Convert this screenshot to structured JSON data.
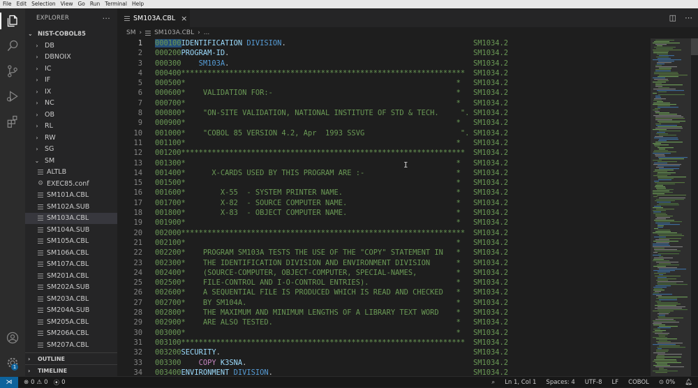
{
  "menu": [
    "File",
    "Edit",
    "Selection",
    "View",
    "Go",
    "Run",
    "Terminal",
    "Help"
  ],
  "explorer": {
    "title": "EXPLORER",
    "more": "···",
    "root": "NIST-COBOL85",
    "folders": [
      "DB",
      "DBNOIX",
      "IC",
      "IF",
      "IX",
      "NC",
      "OB",
      "RL",
      "RW",
      "SG"
    ],
    "open_folder": "SM",
    "files": [
      "ALTLB",
      "EXEC85.conf",
      "SM101A.CBL",
      "SM102A.SUB",
      "SM103A.CBL",
      "SM104A.SUB",
      "SM105A.CBL",
      "SM106A.CBL",
      "SM107A.CBL",
      "SM201A.CBL",
      "SM202A.SUB",
      "SM203A.CBL",
      "SM204A.SUB",
      "SM205A.CBL",
      "SM206A.CBL",
      "SM207A.CBL"
    ],
    "selected_file": "SM103A.CBL",
    "outline": "OUTLINE",
    "timeline": "TIMELINE"
  },
  "tab": {
    "label": "SM103A.CBL",
    "close": "×"
  },
  "breadcrumb": {
    "folder": "SM",
    "file": "SM103A.CBL",
    "more": "..."
  },
  "code": {
    "sequence_tag": "SM1034.2",
    "lines": [
      {
        "n": "1",
        "seq": "000100",
        "parts": [
          [
            "kw2",
            "IDENTIFICATION "
          ],
          [
            "kw",
            "DIVISION"
          ],
          [
            "txt",
            "."
          ]
        ]
      },
      {
        "n": "2",
        "seq": "000200",
        "parts": [
          [
            "kw2",
            "PROGRAM-ID"
          ],
          [
            "txt",
            "."
          ]
        ]
      },
      {
        "n": "3",
        "seq": "000300",
        "parts": [
          [
            "txt",
            "    "
          ],
          [
            "kw",
            "SM103A"
          ],
          [
            "txt",
            "."
          ]
        ]
      },
      {
        "n": "4",
        "seq": "000400",
        "parts": [
          [
            "cmt",
            "*****************************************************************"
          ]
        ]
      },
      {
        "n": "5",
        "seq": "000500",
        "parts": [
          [
            "cmt",
            "*                                                              *"
          ]
        ]
      },
      {
        "n": "6",
        "seq": "000600",
        "parts": [
          [
            "cmt",
            "*    VALIDATION FOR:-                                          *"
          ]
        ]
      },
      {
        "n": "7",
        "seq": "000700",
        "parts": [
          [
            "cmt",
            "*                                                              *"
          ]
        ]
      },
      {
        "n": "8",
        "seq": "000800",
        "parts": [
          [
            "cmt",
            "*    \"ON-SITE VALIDATION, NATIONAL INSTITUTE OF STD & TECH.     \"."
          ]
        ]
      },
      {
        "n": "9",
        "seq": "000900",
        "parts": [
          [
            "cmt",
            "*                                                              *"
          ]
        ]
      },
      {
        "n": "10",
        "seq": "001000",
        "parts": [
          [
            "cmt",
            "*    \"COBOL 85 VERSION 4.2, Apr  1993 SSVG                      \"."
          ]
        ]
      },
      {
        "n": "11",
        "seq": "001100",
        "parts": [
          [
            "cmt",
            "*                                                              *"
          ]
        ]
      },
      {
        "n": "12",
        "seq": "001200",
        "parts": [
          [
            "cmt",
            "*****************************************************************"
          ]
        ]
      },
      {
        "n": "13",
        "seq": "001300",
        "parts": [
          [
            "cmt",
            "*                                                              *"
          ]
        ]
      },
      {
        "n": "14",
        "seq": "001400",
        "parts": [
          [
            "cmt",
            "*      X-CARDS USED BY THIS PROGRAM ARE :-                     *"
          ]
        ]
      },
      {
        "n": "15",
        "seq": "001500",
        "parts": [
          [
            "cmt",
            "*                                                              *"
          ]
        ]
      },
      {
        "n": "16",
        "seq": "001600",
        "parts": [
          [
            "cmt",
            "*        X-55  - SYSTEM PRINTER NAME.                          *"
          ]
        ]
      },
      {
        "n": "17",
        "seq": "001700",
        "parts": [
          [
            "cmt",
            "*        X-82  - SOURCE COMPUTER NAME.                         *"
          ]
        ]
      },
      {
        "n": "18",
        "seq": "001800",
        "parts": [
          [
            "cmt",
            "*        X-83  - OBJECT COMPUTER NAME.                         *"
          ]
        ]
      },
      {
        "n": "19",
        "seq": "001900",
        "parts": [
          [
            "cmt",
            "*                                                              *"
          ]
        ]
      },
      {
        "n": "20",
        "seq": "002000",
        "parts": [
          [
            "cmt",
            "*****************************************************************"
          ]
        ]
      },
      {
        "n": "21",
        "seq": "002100",
        "parts": [
          [
            "cmt",
            "*                                                              *"
          ]
        ]
      },
      {
        "n": "22",
        "seq": "002200",
        "parts": [
          [
            "cmt",
            "*    PROGRAM SM103A TESTS THE USE OF THE \"COPY\" STATEMENT IN   *"
          ]
        ]
      },
      {
        "n": "23",
        "seq": "002300",
        "parts": [
          [
            "cmt",
            "*    THE IDENTIFICATION DIVISION AND ENVIRONMENT DIVISION      *"
          ]
        ]
      },
      {
        "n": "24",
        "seq": "002400",
        "parts": [
          [
            "cmt",
            "*    (SOURCE-COMPUTER, OBJECT-COMPUTER, SPECIAL-NAMES,         *"
          ]
        ]
      },
      {
        "n": "25",
        "seq": "002500",
        "parts": [
          [
            "cmt",
            "*    FILE-CONTROL AND I-O-CONTROL ENTRIES).                    *"
          ]
        ]
      },
      {
        "n": "26",
        "seq": "002600",
        "parts": [
          [
            "cmt",
            "*    A SEQUENTIAL FILE IS PRODUCED WHICH IS READ AND CHECKED   *"
          ]
        ]
      },
      {
        "n": "27",
        "seq": "002700",
        "parts": [
          [
            "cmt",
            "*    BY SM104A.                                                *"
          ]
        ]
      },
      {
        "n": "28",
        "seq": "002800",
        "parts": [
          [
            "cmt",
            "*    THE MAXIMUM AND MINIMUM LENGTHS OF A LIBRARY TEXT WORD    *"
          ]
        ]
      },
      {
        "n": "29",
        "seq": "002900",
        "parts": [
          [
            "cmt",
            "*    ARE ALSO TESTED.                                          *"
          ]
        ]
      },
      {
        "n": "30",
        "seq": "003000",
        "parts": [
          [
            "cmt",
            "*                                                              *"
          ]
        ]
      },
      {
        "n": "31",
        "seq": "003100",
        "parts": [
          [
            "cmt",
            "*****************************************************************"
          ]
        ]
      },
      {
        "n": "32",
        "seq": "003200",
        "parts": [
          [
            "kw2",
            "SECURITY"
          ],
          [
            "txt",
            "."
          ]
        ]
      },
      {
        "n": "33",
        "seq": "003300",
        "parts": [
          [
            "txt",
            "    "
          ],
          [
            "kw3",
            "COPY "
          ],
          [
            "kw2",
            "K3SNA"
          ],
          [
            "txt",
            "."
          ]
        ]
      },
      {
        "n": "34",
        "seq": "003400",
        "parts": [
          [
            "kw2",
            "ENVIRONMENT "
          ],
          [
            "kw",
            "DIVISION"
          ],
          [
            "txt",
            "."
          ]
        ]
      }
    ]
  },
  "status": {
    "errors": "0",
    "warnings": "0",
    "ports": "0",
    "position": "Ln 1, Col 1",
    "spaces": "Spaces: 4",
    "encoding": "UTF-8",
    "eol": "LF",
    "language": "COBOL",
    "copilot": "0%"
  },
  "accounts_badge": "1"
}
